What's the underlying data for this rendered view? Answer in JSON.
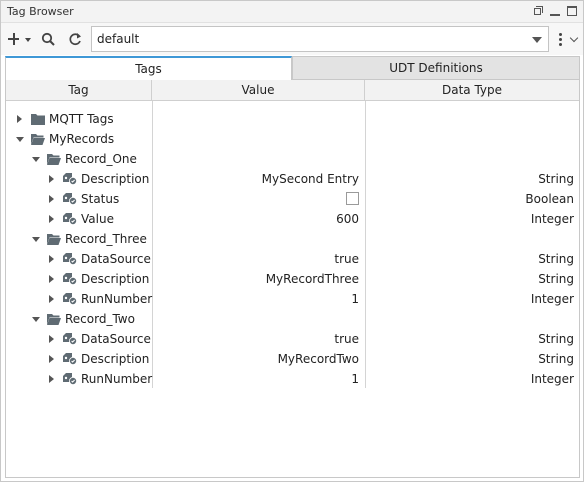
{
  "window": {
    "title": "Tag Browser"
  },
  "toolbar": {
    "provider_value": "default",
    "icons": [
      "add-icon",
      "search-icon",
      "refresh-icon",
      "more-vert-icon",
      "chevron-down-icon"
    ]
  },
  "tabs": [
    {
      "label": "Tags",
      "active": true
    },
    {
      "label": "UDT Definitions",
      "active": false
    }
  ],
  "columns": {
    "tag": "Tag",
    "value": "Value",
    "datatype": "Data Type"
  },
  "colors": {
    "accent": "#3f98d6",
    "folder": "#5f6b73",
    "tag_icon": "#5f6b73"
  },
  "rows": [
    {
      "name": "MQTT Tags",
      "kind": "folder",
      "depth": 0,
      "expanded": false,
      "value": "",
      "datatype": ""
    },
    {
      "name": "MyRecords",
      "kind": "folder",
      "depth": 0,
      "expanded": true,
      "value": "",
      "datatype": ""
    },
    {
      "name": "Record_One",
      "kind": "folder",
      "depth": 1,
      "expanded": true,
      "value": "",
      "datatype": ""
    },
    {
      "name": "Description",
      "kind": "tag",
      "depth": 2,
      "expanded": false,
      "value": "MySecond Entry",
      "datatype": "String"
    },
    {
      "name": "Status",
      "kind": "tag",
      "depth": 2,
      "expanded": false,
      "value": "",
      "checkbox": false,
      "datatype": "Boolean"
    },
    {
      "name": "Value",
      "kind": "tag",
      "depth": 2,
      "expanded": false,
      "value": "600",
      "datatype": "Integer"
    },
    {
      "name": "Record_Three",
      "kind": "folder",
      "depth": 1,
      "expanded": true,
      "value": "",
      "datatype": ""
    },
    {
      "name": "DataSource",
      "kind": "tag",
      "depth": 2,
      "expanded": false,
      "value": "true",
      "datatype": "String"
    },
    {
      "name": "Description",
      "kind": "tag",
      "depth": 2,
      "expanded": false,
      "value": "MyRecordThree",
      "datatype": "String"
    },
    {
      "name": "RunNumber",
      "kind": "tag",
      "depth": 2,
      "expanded": false,
      "value": "1",
      "datatype": "Integer"
    },
    {
      "name": "Record_Two",
      "kind": "folder",
      "depth": 1,
      "expanded": true,
      "value": "",
      "datatype": ""
    },
    {
      "name": "DataSource",
      "kind": "tag",
      "depth": 2,
      "expanded": false,
      "value": "true",
      "datatype": "String"
    },
    {
      "name": "Description",
      "kind": "tag",
      "depth": 2,
      "expanded": false,
      "value": "MyRecordTwo",
      "datatype": "String"
    },
    {
      "name": "RunNumber",
      "kind": "tag",
      "depth": 2,
      "expanded": false,
      "value": "1",
      "datatype": "Integer"
    }
  ]
}
